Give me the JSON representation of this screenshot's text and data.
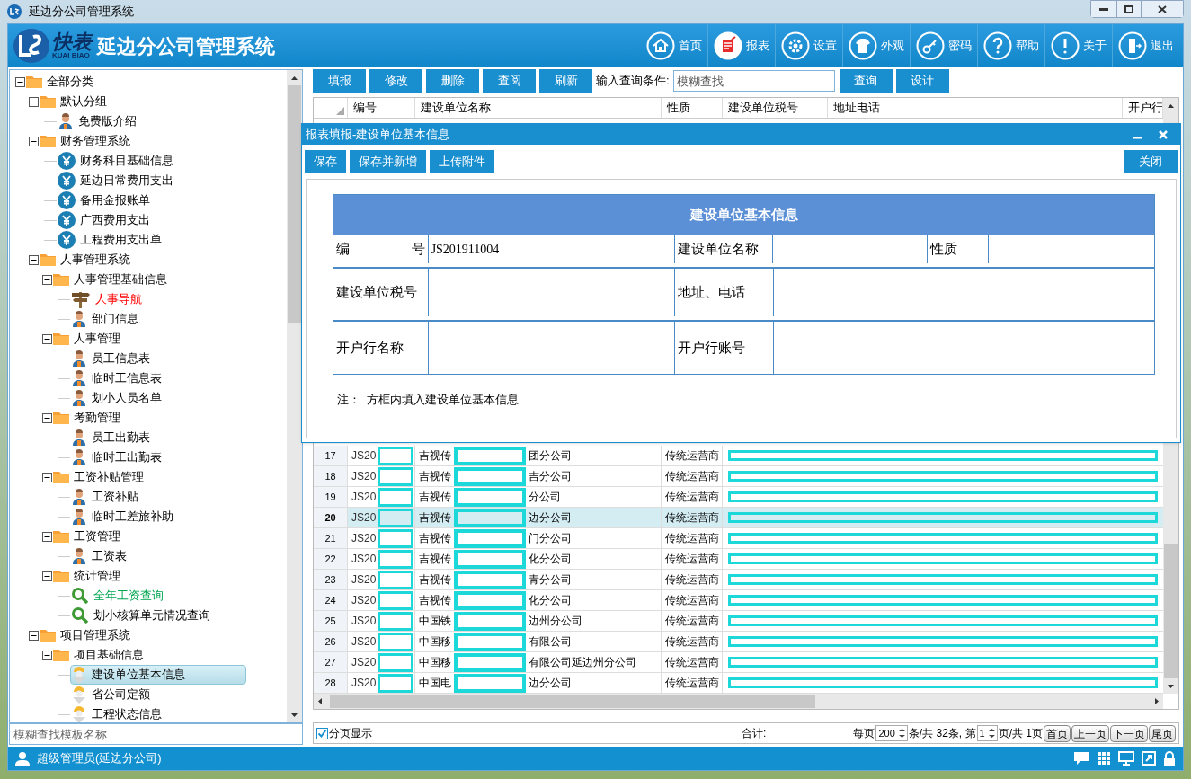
{
  "window": {
    "title": "延边分公司管理系统"
  },
  "header": {
    "logo_name": "快表",
    "logo_sub": "KUAI BIAO",
    "title": "延边分公司管理系统",
    "nav": [
      {
        "label": "首页",
        "selected": false
      },
      {
        "label": "报表",
        "selected": true
      },
      {
        "label": "设置",
        "selected": false
      },
      {
        "label": "外观",
        "selected": false
      },
      {
        "label": "密码",
        "selected": false
      },
      {
        "label": "帮助",
        "selected": false
      },
      {
        "label": "关于",
        "selected": false
      },
      {
        "label": "退出",
        "selected": false
      }
    ]
  },
  "tree": [
    {
      "label": "全部分类",
      "kind": "folder",
      "expanded": true,
      "selected": false,
      "children": [
        {
          "label": "默认分组",
          "kind": "folder",
          "expanded": true,
          "selected": false,
          "children": [
            {
              "label": "免费版介绍",
              "kind": "person",
              "selected": false
            }
          ]
        },
        {
          "label": "财务管理系统",
          "kind": "folder",
          "expanded": true,
          "selected": false,
          "children": [
            {
              "label": "财务科目基础信息",
              "kind": "yen",
              "selected": false
            },
            {
              "label": "延边日常费用支出",
              "kind": "yen",
              "selected": false
            },
            {
              "label": "备用金报账单",
              "kind": "yen",
              "selected": false
            },
            {
              "label": "广西费用支出",
              "kind": "yen",
              "selected": false
            },
            {
              "label": "工程费用支出单",
              "kind": "yen",
              "selected": false
            }
          ]
        },
        {
          "label": "人事管理系统",
          "kind": "folder",
          "expanded": true,
          "selected": false,
          "children": [
            {
              "label": "人事管理基础信息",
              "kind": "folder",
              "expanded": true,
              "selected": false,
              "children": [
                {
                  "label": "人事导航",
                  "kind": "signpost",
                  "selected": false,
                  "color": "#ff0000"
                },
                {
                  "label": "部门信息",
                  "kind": "person",
                  "selected": false
                }
              ]
            },
            {
              "label": "人事管理",
              "kind": "folder",
              "expanded": true,
              "selected": false,
              "children": [
                {
                  "label": "员工信息表",
                  "kind": "person",
                  "selected": false
                },
                {
                  "label": "临时工信息表",
                  "kind": "person",
                  "selected": false
                },
                {
                  "label": "划小人员名单",
                  "kind": "person",
                  "selected": false
                }
              ]
            },
            {
              "label": "考勤管理",
              "kind": "folder",
              "expanded": true,
              "selected": false,
              "children": [
                {
                  "label": "员工出勤表",
                  "kind": "person",
                  "selected": false
                },
                {
                  "label": "临时工出勤表",
                  "kind": "person",
                  "selected": false
                }
              ]
            },
            {
              "label": "工资补贴管理",
              "kind": "folder",
              "expanded": true,
              "selected": false,
              "children": [
                {
                  "label": "工资补贴",
                  "kind": "person",
                  "selected": false
                },
                {
                  "label": "临时工差旅补助",
                  "kind": "person",
                  "selected": false
                }
              ]
            },
            {
              "label": "工资管理",
              "kind": "folder",
              "expanded": true,
              "selected": false,
              "children": [
                {
                  "label": "工资表",
                  "kind": "person",
                  "selected": false
                }
              ]
            },
            {
              "label": "统计管理",
              "kind": "folder",
              "expanded": true,
              "selected": false,
              "children": [
                {
                  "label": "全年工资查询",
                  "kind": "search",
                  "selected": false,
                  "color": "#00a651"
                },
                {
                  "label": "划小核算单元情况查询",
                  "kind": "search",
                  "selected": false
                }
              ]
            }
          ]
        },
        {
          "label": "项目管理系统",
          "kind": "folder",
          "expanded": true,
          "selected": false,
          "children": [
            {
              "label": "项目基础信息",
              "kind": "folder",
              "expanded": true,
              "selected": false,
              "children": [
                {
                  "label": "建设单位基本信息",
                  "kind": "helmet",
                  "selected": true
                },
                {
                  "label": "省公司定额",
                  "kind": "helmet",
                  "selected": false
                },
                {
                  "label": "工程状态信息",
                  "kind": "helmet",
                  "selected": false
                }
              ]
            }
          ]
        }
      ]
    }
  ],
  "tree_search": {
    "placeholder": "模糊查找模板名称"
  },
  "user": "超级管理员(延边分公司)",
  "toolbar": {
    "buttons": [
      "填报",
      "修改",
      "删除",
      "查阅",
      "刷新"
    ],
    "query_label": "输入查询条件:",
    "query_placeholder": "模糊查找",
    "query_buttons": [
      "查询",
      "设计"
    ]
  },
  "table": {
    "columns": [
      "",
      "编号",
      "建设单位名称",
      "性质",
      "建设单位税号",
      "地址电话",
      "开户行"
    ],
    "rows": [
      {
        "num": "17",
        "id": "JS20",
        "name_start": "吉视传",
        "name_end": "团分公司",
        "type": "传统运营商",
        "selected": false
      },
      {
        "num": "18",
        "id": "JS20",
        "name_start": "吉视传",
        "name_end": "吉分公司",
        "type": "传统运营商",
        "selected": false
      },
      {
        "num": "19",
        "id": "JS20",
        "name_start": "吉视传",
        "name_end": "分公司",
        "type": "传统运营商",
        "selected": false
      },
      {
        "num": "20",
        "id": "JS20",
        "name_start": "吉视传",
        "name_end": "边分公司",
        "type": "传统运营商",
        "selected": true
      },
      {
        "num": "21",
        "id": "JS20",
        "name_start": "吉视传",
        "name_end": "门分公司",
        "type": "传统运营商",
        "selected": false
      },
      {
        "num": "22",
        "id": "JS20",
        "name_start": "吉视传",
        "name_end": "化分公司",
        "type": "传统运营商",
        "selected": false
      },
      {
        "num": "23",
        "id": "JS20",
        "name_start": "吉视传",
        "name_end": "青分公司",
        "type": "传统运营商",
        "selected": false
      },
      {
        "num": "24",
        "id": "JS20",
        "name_start": "吉视传",
        "name_end": "化分公司",
        "type": "传统运营商",
        "selected": false
      },
      {
        "num": "25",
        "id": "JS20",
        "name_start": "中国铁",
        "name_end": "边州分公司",
        "type": "传统运营商",
        "selected": false
      },
      {
        "num": "26",
        "id": "JS20",
        "name_start": "中国移",
        "name_end": "有限公司",
        "type": "传统运营商",
        "selected": false
      },
      {
        "num": "27",
        "id": "JS20",
        "name_start": "中国移",
        "name_end": "有限公司延边州分公司",
        "type": "传统运营商",
        "selected": false
      },
      {
        "num": "28",
        "id": "JS20",
        "name_start": "中国电",
        "name_end": "边分公司",
        "type": "传统运营商",
        "selected": false
      }
    ]
  },
  "pager": {
    "paged": true,
    "paged_label": "分页显示",
    "total_label": "合计:",
    "per_page_label": "每页",
    "per_page": "200",
    "count_text": "条/共 32条, 第",
    "page": "1",
    "pages_text": "页/共 1页",
    "buttons": [
      "首页",
      "上一页",
      "下一页",
      "尾页"
    ]
  },
  "dialog": {
    "title": "报表填报-建设单位基本信息",
    "buttons": [
      "保存",
      "保存并新增",
      "上传附件"
    ],
    "close_button": "关闭",
    "form_title": "建设单位基本信息",
    "rows": [
      [
        {
          "kind": "label",
          "text": "编号"
        },
        {
          "kind": "value",
          "text": "JS201911004"
        },
        {
          "kind": "label",
          "text": "建设单位名称"
        },
        {
          "kind": "value",
          "text": ""
        },
        {
          "kind": "label",
          "text": "性质"
        },
        {
          "kind": "value",
          "text": ""
        }
      ],
      [
        {
          "kind": "label",
          "text": "建设单位税号"
        },
        {
          "kind": "value",
          "text": ""
        },
        {
          "kind": "label",
          "text": "地址、电话"
        },
        {
          "kind": "value",
          "text": ""
        }
      ],
      [
        {
          "kind": "label",
          "text": "开户行名称"
        },
        {
          "kind": "value",
          "text": ""
        },
        {
          "kind": "label",
          "text": "开户行账号"
        },
        {
          "kind": "value",
          "text": ""
        }
      ]
    ],
    "note": "注：  方框内填入建设单位基本信息"
  }
}
